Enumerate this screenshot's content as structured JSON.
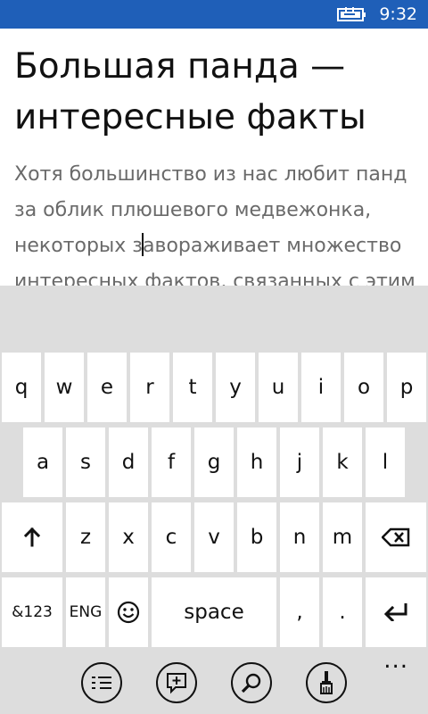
{
  "status_bar": {
    "time": "9:32",
    "icons": [
      "battery-charging-icon"
    ],
    "bg_color": "#1f5fb8"
  },
  "document": {
    "title_lines": [
      "Большая панда —",
      "интересные факты"
    ],
    "body_lines": [
      "Хотя большинство из нас любит панд",
      "за облик плюшевого медвежонка,",
      {
        "before_caret": "некоторых з",
        "after_caret": "авораживает множество"
      },
      "интересных фактов, связанных с этим"
    ]
  },
  "keyboard": {
    "row1": [
      "q",
      "w",
      "e",
      "r",
      "t",
      "y",
      "u",
      "i",
      "o",
      "p"
    ],
    "row2": [
      "a",
      "s",
      "d",
      "f",
      "g",
      "h",
      "j",
      "k",
      "l"
    ],
    "row3": {
      "shift_icon": "shift-arrow-icon",
      "letters": [
        "z",
        "x",
        "c",
        "v",
        "b",
        "n",
        "m"
      ],
      "backspace_icon": "backspace-icon"
    },
    "row4": {
      "symbols": "&123",
      "language": "ENG",
      "emoji_icon": "emoji-smiley-icon",
      "space": "space",
      "comma": ",",
      "period": ".",
      "enter_icon": "enter-icon"
    }
  },
  "app_bar": {
    "buttons": [
      "list-icon",
      "comment-add-icon",
      "search-icon",
      "format-brush-icon"
    ],
    "more": "..."
  }
}
